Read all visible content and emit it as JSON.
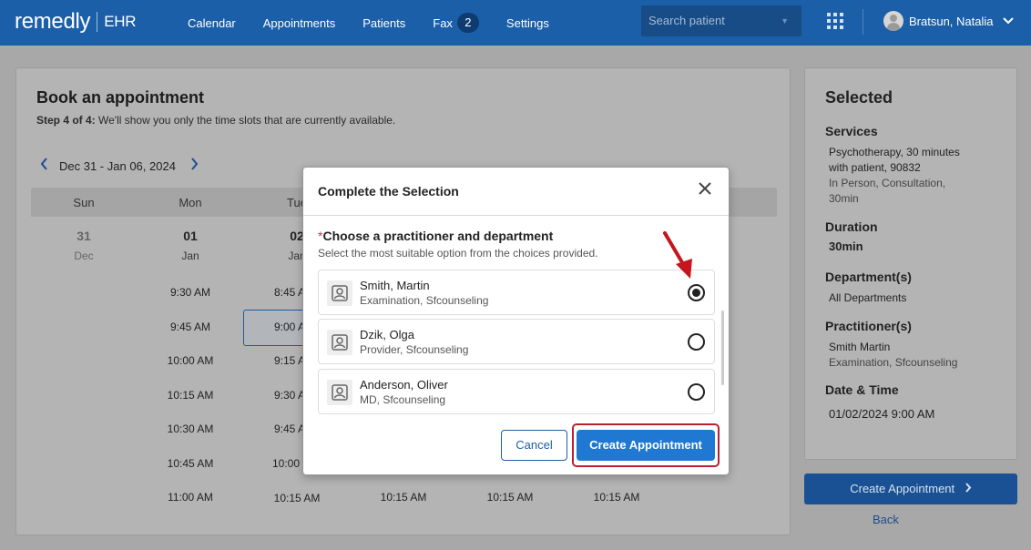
{
  "header": {
    "logo_main": "remedly",
    "logo_sub": "EHR",
    "nav": [
      "Calendar",
      "Appointments",
      "Patients",
      "Fax",
      "Settings"
    ],
    "fax_badge": "2",
    "search_placeholder": "Search patient",
    "user_name": "Bratsun, Natalia"
  },
  "booking": {
    "title": "Book an appointment",
    "step_label": "Step 4 of 4:",
    "step_text": " We'll show you only the time slots that are currently available.",
    "week_range": "Dec 31 - Jan 06, 2024",
    "days": [
      {
        "name": "Sun",
        "num": "31",
        "month": "Dec"
      },
      {
        "name": "Mon",
        "num": "01",
        "month": "Jan"
      },
      {
        "name": "Tue",
        "num": "02",
        "month": "Jan"
      }
    ],
    "mon_slots": [
      "9:30 AM",
      "9:45 AM",
      "10:00 AM",
      "10:15 AM",
      "10:30 AM",
      "10:45 AM",
      "11:00 AM"
    ],
    "tue_slots": [
      "8:45 A",
      "9:00 A",
      "9:15 A",
      "9:30 A",
      "9:45 A",
      "10:00",
      "10:15 AM"
    ],
    "extra_slots": [
      "10:15 AM",
      "10:15 AM",
      "10:15 AM"
    ]
  },
  "selected": {
    "title": "Selected",
    "services_label": "Services",
    "services_line1": "Psychotherapy, 30 minutes",
    "services_line2": "with patient, 90832",
    "services_line3": "In Person, Consultation,",
    "services_line4": "30min",
    "duration_label": "Duration",
    "duration_value": "30min",
    "department_label": "Department(s)",
    "department_value": "All Departments",
    "practitioner_label": "Practitioner(s)",
    "practitioner_name": "Smith Martin",
    "practitioner_sub": "Examination, Sfcounseling",
    "datetime_label": "Date & Time",
    "datetime_value": "01/02/2024 9:00 AM",
    "create_button": "Create Appointment",
    "back_link": "Back"
  },
  "modal": {
    "title": "Complete the Selection",
    "question_mark": "*",
    "question": "Choose a practitioner and department",
    "hint": "Select the most suitable option from the choices provided.",
    "options": [
      {
        "name": "Smith, Martin",
        "sub": "Examination, Sfcounseling",
        "selected": true
      },
      {
        "name": "Dzik, Olga",
        "sub": "Provider, Sfcounseling",
        "selected": false
      },
      {
        "name": "Anderson, Oliver",
        "sub": "MD, Sfcounseling",
        "selected": false
      }
    ],
    "cancel": "Cancel",
    "create": "Create Appointment"
  },
  "colors": {
    "brand": "#1a5fa8",
    "primary_button": "#1f78d1",
    "highlight": "#b82134"
  }
}
